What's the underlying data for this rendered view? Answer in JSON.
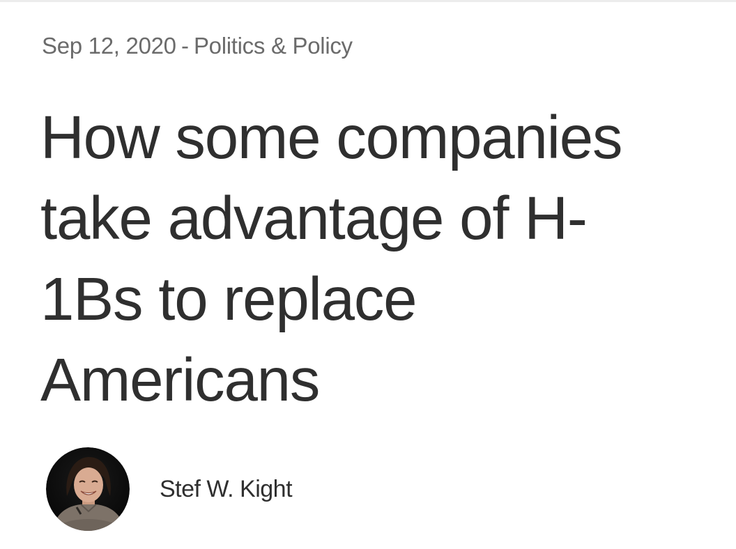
{
  "article": {
    "date": "Sep 12, 2020",
    "separator": "-",
    "category": "Politics & Policy",
    "title_lines": [
      "How some companies",
      "take advantage of H-",
      "1Bs to replace",
      "Americans"
    ],
    "author": "Stef W. Kight"
  },
  "colors": {
    "meta_text": "#6b6b6b",
    "headline_text": "#2f2f2f",
    "background": "#ffffff"
  }
}
